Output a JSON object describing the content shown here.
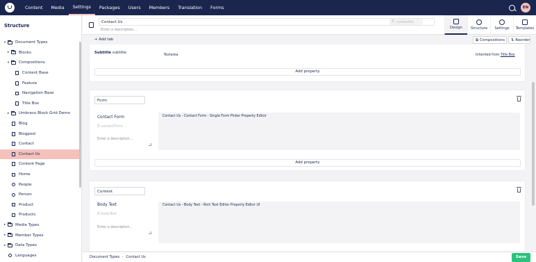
{
  "topnav": {
    "items": [
      "Content",
      "Media",
      "Settings",
      "Packages",
      "Users",
      "Members",
      "Translation",
      "Forms"
    ],
    "active": "Settings"
  },
  "user": {
    "initials": "EN"
  },
  "sidebar": {
    "title": "Structure",
    "items": [
      {
        "label": "Document Types",
        "arrow": "▾",
        "icon": "folder-icon",
        "indent": 0
      },
      {
        "label": "Blocks",
        "arrow": "▸",
        "icon": "folder-icon",
        "indent": 1
      },
      {
        "label": "Compositions",
        "arrow": "▾",
        "icon": "folder-icon",
        "indent": 1
      },
      {
        "label": "Content Base",
        "arrow": "",
        "icon": "document-icon",
        "indent": 2
      },
      {
        "label": "Feature",
        "arrow": "",
        "icon": "pen-icon",
        "indent": 2
      },
      {
        "label": "Navigation Base",
        "arrow": "",
        "icon": "nav-icon",
        "indent": 2
      },
      {
        "label": "Title Box",
        "arrow": "",
        "icon": "document-icon",
        "indent": 2
      },
      {
        "label": "Umbraco Block Grid Demo",
        "arrow": "▸",
        "icon": "folder-icon",
        "indent": 1
      },
      {
        "label": "Blog",
        "arrow": "",
        "icon": "document-icon",
        "indent": 1
      },
      {
        "label": "Blogpost",
        "arrow": "",
        "icon": "document-icon",
        "indent": 1
      },
      {
        "label": "Contact",
        "arrow": "",
        "icon": "pen-icon",
        "indent": 1
      },
      {
        "label": "Contact Us",
        "arrow": "",
        "icon": "document-icon",
        "indent": 1,
        "active": true
      },
      {
        "label": "Content Page",
        "arrow": "",
        "icon": "document-icon",
        "indent": 1
      },
      {
        "label": "Home",
        "arrow": "",
        "icon": "home-icon",
        "indent": 1
      },
      {
        "label": "People",
        "arrow": "",
        "icon": "people-icon",
        "indent": 1
      },
      {
        "label": "Person",
        "arrow": "",
        "icon": "person-icon",
        "indent": 1
      },
      {
        "label": "Product",
        "arrow": "",
        "icon": "product-icon",
        "indent": 1
      },
      {
        "label": "Products",
        "arrow": "",
        "icon": "cart-icon",
        "indent": 1
      },
      {
        "label": "Media Types",
        "arrow": "▸",
        "icon": "folder-icon",
        "indent": 0
      },
      {
        "label": "Member Types",
        "arrow": "▸",
        "icon": "folder-icon",
        "indent": 0
      },
      {
        "label": "Data Types",
        "arrow": "▸",
        "icon": "folder-icon",
        "indent": 0
      },
      {
        "label": "Languages",
        "arrow": "",
        "icon": "globe-icon",
        "indent": 0
      }
    ]
  },
  "header": {
    "name_value": "Contact Us",
    "alias_value": "contactUs",
    "description_placeholder": "Enter a description...",
    "tabs": [
      {
        "label": "Design",
        "icon": "document-icon",
        "active": true
      },
      {
        "label": "Structure",
        "icon": "structure-icon"
      },
      {
        "label": "Settings",
        "icon": "gear-icon"
      },
      {
        "label": "Templates",
        "icon": "templates-icon"
      }
    ]
  },
  "toolbar": {
    "add_tab": "+ Add tab",
    "compositions": "Compositions",
    "reorder": "Reorder"
  },
  "inherited_group": {
    "prop_name": "Subtitle",
    "prop_alias": "subtitle",
    "editor": "Textarea",
    "inherited_prefix": "Inherited from",
    "inherited_from": "Title Box",
    "add_property": "Add property"
  },
  "form_group": {
    "name": "Form",
    "prop_name": "Contact Form",
    "prop_alias": "contactForm",
    "description_placeholder": "Enter a description...",
    "editor": "Contact Us - Contact Form - Single Form Picker Property Editor",
    "add_property": "Add property"
  },
  "content_group": {
    "name": "Content",
    "prop_name": "Body Text",
    "prop_alias": "bodyText",
    "description_placeholder": "Enter a description...",
    "editor": "Contact Us - Body Text - Rich Text Editor Property Editor UI"
  },
  "footer": {
    "crumbs": [
      "Document Types",
      "Contact Us"
    ],
    "save": "Save"
  }
}
